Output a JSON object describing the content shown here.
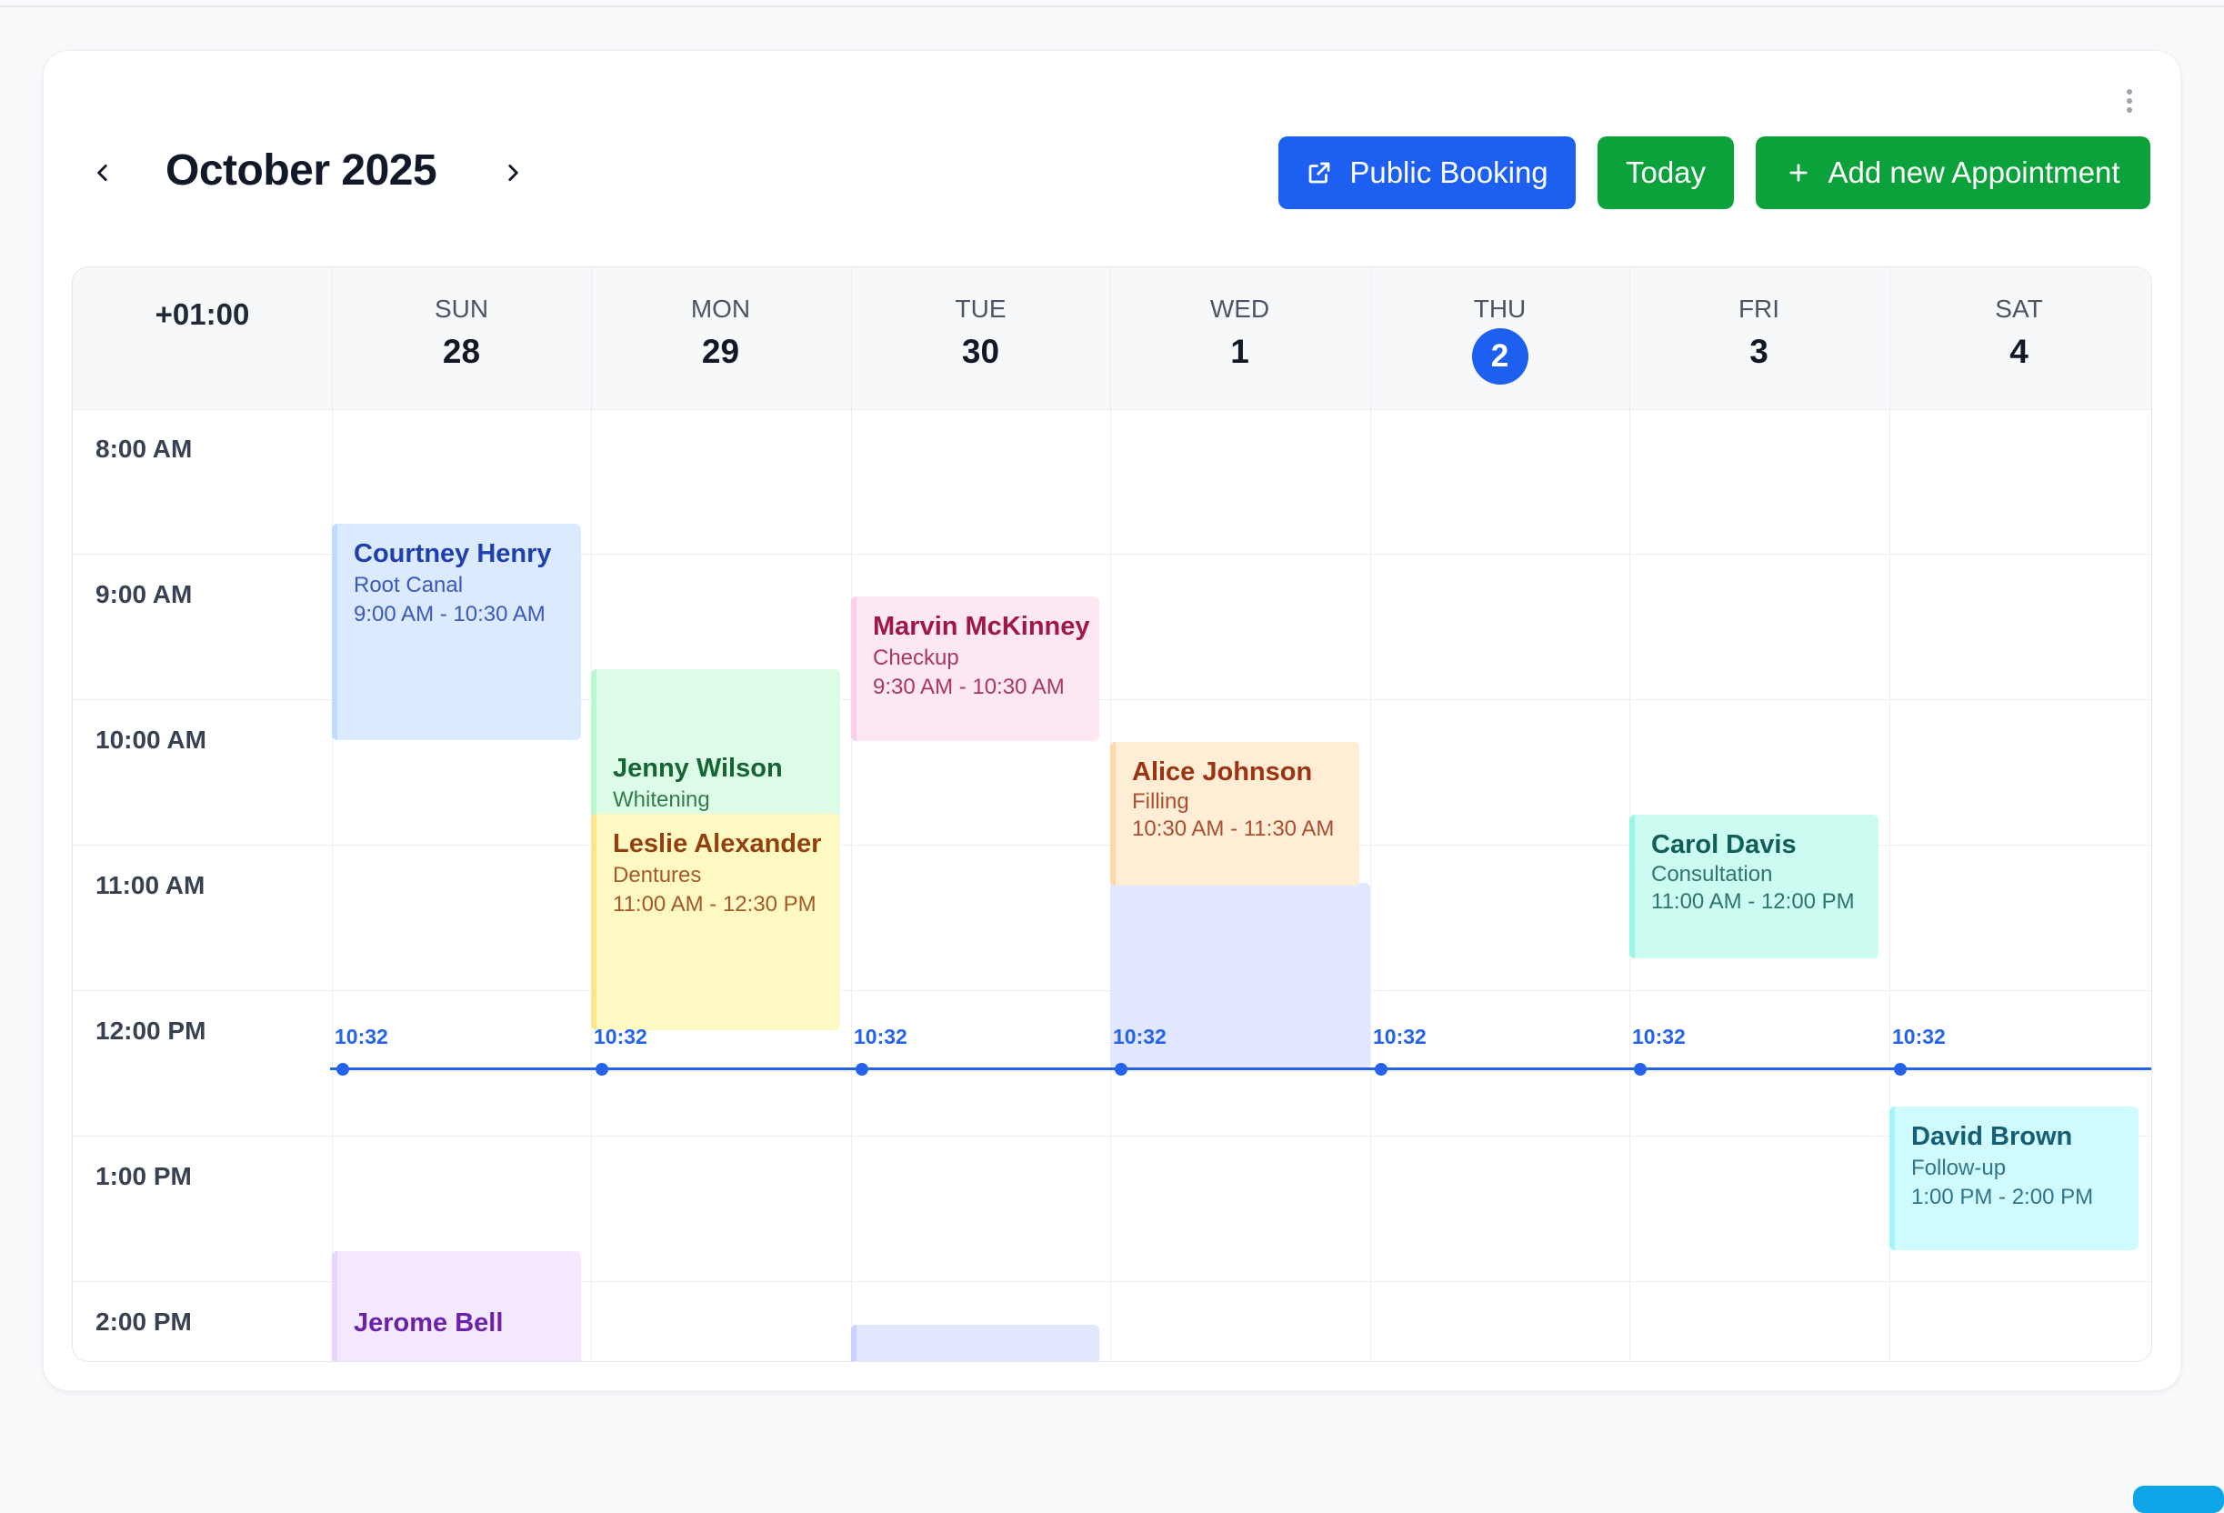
{
  "calendar": {
    "title": "October 2025",
    "timezone": "+01:00",
    "prev_label": "Previous month",
    "next_label": "Next month"
  },
  "toolbar": {
    "public_booking_label": "Public Booking",
    "today_label": "Today",
    "add_label": "Add new Appointment"
  },
  "days": [
    {
      "name": "SUN",
      "num": "28"
    },
    {
      "name": "MON",
      "num": "29"
    },
    {
      "name": "TUE",
      "num": "30"
    },
    {
      "name": "WED",
      "num": "1"
    },
    {
      "name": "THU",
      "num": "2",
      "today": true
    },
    {
      "name": "FRI",
      "num": "3"
    },
    {
      "name": "SAT",
      "num": "4"
    }
  ],
  "time_slots": [
    "8:00 AM",
    "9:00 AM",
    "10:00 AM",
    "11:00 AM",
    "12:00 PM",
    "1:00 PM",
    "2:00 PM"
  ],
  "current_time": "10:32",
  "appointments": [
    {
      "name": "Courtney Henry",
      "service": "Root Canal",
      "time": "9:00 AM - 10:30 AM",
      "color": "blue"
    },
    {
      "name": "Jenny Wilson",
      "service": "Whitening",
      "time": "",
      "color": "green"
    },
    {
      "name": "Leslie Alexander",
      "service": "Dentures",
      "time": "11:00 AM - 12:30 PM",
      "color": "yellow"
    },
    {
      "name": "Marvin McKinney",
      "service": "Checkup",
      "time": "9:30 AM - 10:30 AM",
      "color": "pink"
    },
    {
      "name": "Alice Johnson",
      "service": "Filling",
      "time": "10:30 AM - 11:30 AM",
      "color": "orange"
    },
    {
      "name": "Carol Davis",
      "service": "Consultation",
      "time": "11:00 AM - 12:00 PM",
      "color": "teal"
    },
    {
      "name": "David Brown",
      "service": "Follow-up",
      "time": "1:00 PM - 2:00 PM",
      "color": "cyan"
    },
    {
      "name": "Jerome Bell",
      "service": "",
      "time": "",
      "color": "purple"
    }
  ],
  "colors": {
    "primary_blue": "#1d5ff0",
    "green": "#0ca23b",
    "now_line": "#2563eb"
  }
}
